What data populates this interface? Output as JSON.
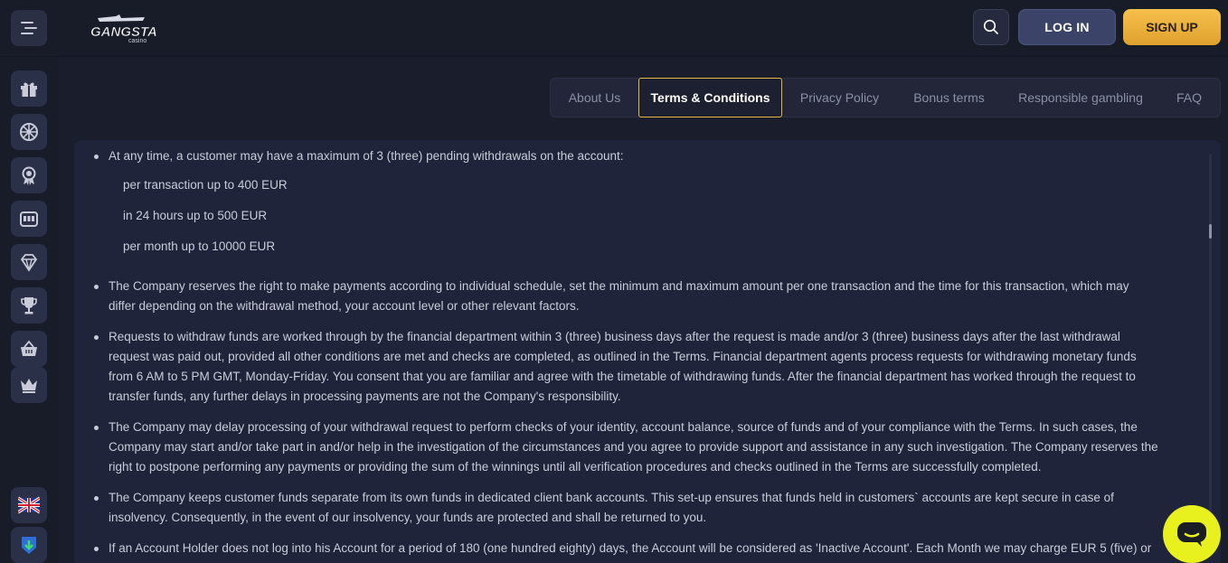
{
  "header": {
    "logo_text": "GANGSTA",
    "logo_subtext": "casino",
    "login_label": "LOG IN",
    "signup_label": "SIGN UP"
  },
  "sidebar": {
    "items": [
      {
        "icon": "gift-icon"
      },
      {
        "icon": "wheel-icon"
      },
      {
        "icon": "award-icon"
      },
      {
        "icon": "slot-machine-icon"
      },
      {
        "icon": "diamond-icon"
      },
      {
        "icon": "trophy-icon"
      },
      {
        "icon": "basket-icon"
      },
      {
        "icon": "crown-icon"
      }
    ],
    "language_icon": "uk-flag-icon",
    "download_icon": "download-icon"
  },
  "tabs": [
    {
      "label": "About Us",
      "active": false
    },
    {
      "label": "Terms & Conditions",
      "active": true
    },
    {
      "label": "Privacy Policy",
      "active": false
    },
    {
      "label": "Bonus terms",
      "active": false
    },
    {
      "label": "Responsible gambling",
      "active": false
    },
    {
      "label": "FAQ",
      "active": false
    }
  ],
  "content": {
    "intro": "At any time, a customer may have a maximum of 3 (three) pending withdrawals on the account:",
    "limits": [
      "per transaction up to 400 EUR",
      "in 24 hours up to 500 EUR",
      "per month up to 10000 EUR"
    ],
    "paragraphs": [
      [
        "The Company reserves the right to make payments according to individual schedule, set the minimum and maximum amount per one transaction and the time for this transaction, which may",
        "differ depending on the withdrawal method, your account level or other relevant factors."
      ],
      [
        "Requests to withdraw funds are worked through by the financial department within 3 (three) business days after the request is made and/or 3 (three) business days after the last withdrawal",
        "request was paid out, provided all other conditions are met and checks are completed, as outlined in the Terms. Financial department agents process requests for withdrawing monetary funds",
        "from 6 AM to 5 PM GMT, Monday-Friday. You consent that you are familiar and agree with the timetable of withdrawing funds. After the financial department has worked through the request to",
        "transfer funds, any further delays in processing payments are not the Company's responsibility."
      ],
      [
        "The Company may delay processing of your withdrawal request to perform checks of your identity, account balance, source of funds and of your compliance with the Terms. In such cases, the",
        "Company may start and/or take part in and/or help in the investigation of the circumstances and you agree to provide support and assistance in any such investigation. The Company reserves the",
        "right to postpone performing any payments or providing the sum of the winnings until all verification procedures and checks outlined in the Terms are successfully completed."
      ],
      [
        "The Company keeps customer funds separate from its own funds in dedicated client bank accounts. This set-up ensures that funds held in customers` accounts are kept secure in case of",
        "insolvency. Consequently, in the event of our insolvency, your funds are protected and shall be returned to you."
      ],
      [
        "If an Account Holder does not log into his Account for a period of 180 (one hundred eighty) days, the Account will be considered as 'Inactive Account'. Each Month we may charge EUR 5 (five) or"
      ]
    ]
  },
  "chat_icon": "chat-bubble-icon"
}
